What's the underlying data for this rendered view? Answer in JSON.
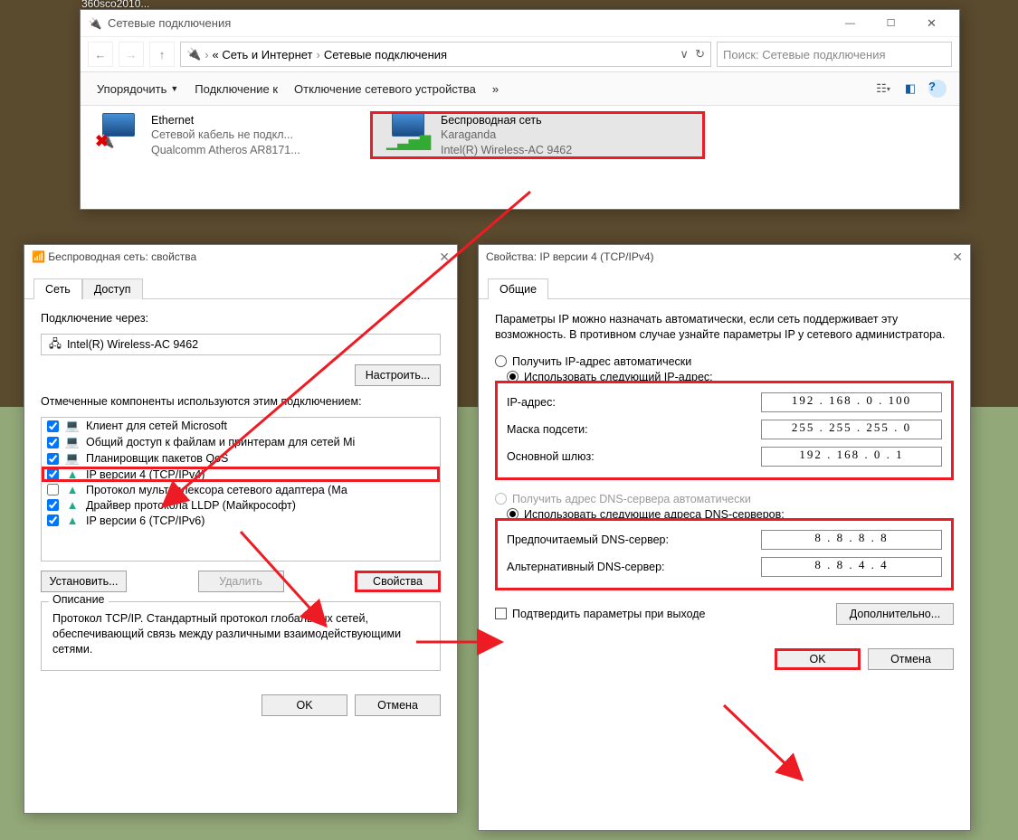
{
  "desktop_shortcut": "360sco2010...",
  "explorer": {
    "title": "Сетевые подключения",
    "breadcrumb": {
      "part1": "« Сеть и Интернет",
      "part2": "Сетевые подключения"
    },
    "search_placeholder": "Поиск: Сетевые подключения",
    "toolbar": {
      "organize": "Упорядочить",
      "connect": "Подключение к",
      "disable": "Отключение сетевого устройства",
      "more": "»"
    },
    "adapter_ethernet": {
      "name": "Ethernet",
      "status": "Сетевой кабель не подкл...",
      "device": "Qualcomm Atheros AR8171..."
    },
    "adapter_wifi": {
      "name": "Беспроводная сеть",
      "status": "Karaganda",
      "device": "Intel(R) Wireless-AC 9462"
    }
  },
  "props": {
    "title": "Беспроводная сеть: свойства",
    "tab_net": "Сеть",
    "tab_access": "Доступ",
    "connect_via": "Подключение через:",
    "adapter": "Intel(R) Wireless-AC 9462",
    "configure": "Настроить...",
    "components_label": "Отмеченные компоненты используются этим подключением:",
    "items": [
      "Клиент для сетей Microsoft",
      "Общий доступ к файлам и принтерам для сетей Mi",
      "Планировщик пакетов QoS",
      "IP версии 4 (TCP/IPv4)",
      "Протокол мультиплексора сетевого адаптера (Ма",
      "Драйвер протокола LLDP (Майкрософт)",
      "IP версии 6 (TCP/IPv6)"
    ],
    "install": "Установить...",
    "remove": "Удалить",
    "properties": "Свойства",
    "desc_label": "Описание",
    "desc": "Протокол TCP/IP. Стандартный протокол глобальных сетей, обеспечивающий связь между различными взаимодействующими сетями.",
    "ok": "OK",
    "cancel": "Отмена"
  },
  "ipv4": {
    "title": "Свойства: IP версии 4 (TCP/IPv4)",
    "tab_general": "Общие",
    "intro": "Параметры IP можно назначать автоматически, если сеть поддерживает эту возможность. В противном случае узнайте параметры IP у сетевого администратора.",
    "auto_ip": "Получить IP-адрес автоматически",
    "manual_ip": "Использовать следующий IP-адрес:",
    "ip_label": "IP-адрес:",
    "ip": "192 . 168 .   0  . 100",
    "mask_label": "Маска подсети:",
    "mask": "255 . 255 . 255 .   0",
    "gw_label": "Основной шлюз:",
    "gw": "192 . 168 .   0   .   1",
    "auto_dns": "Получить адрес DNS-сервера автоматически",
    "manual_dns": "Использовать следующие адреса DNS-серверов:",
    "dns1_label": "Предпочитаемый DNS-сервер:",
    "dns1": "8   .   8   .   8   .   8",
    "dns2_label": "Альтернативный DNS-сервер:",
    "dns2": "8   .   8   .   4   .   4",
    "validate": "Подтвердить параметры при выходе",
    "advanced": "Дополнительно...",
    "ok": "OK",
    "cancel": "Отмена"
  }
}
